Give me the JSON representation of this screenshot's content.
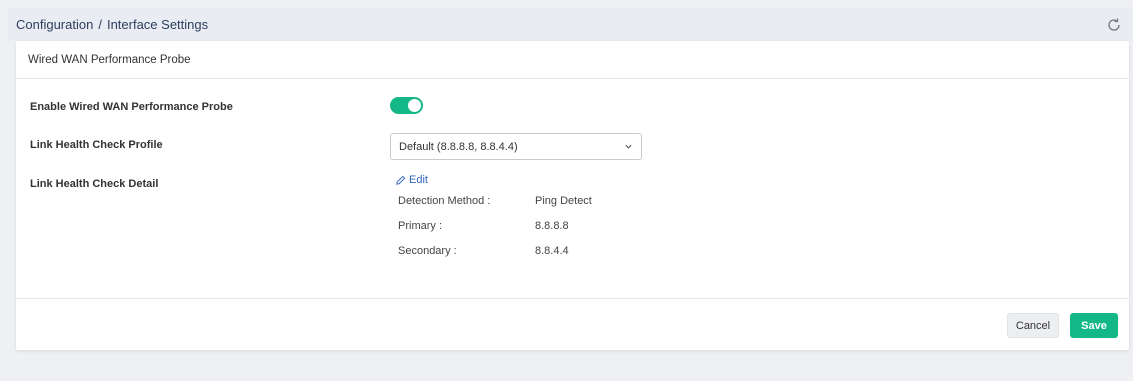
{
  "breadcrumb": {
    "section": "Configuration",
    "separator": "/",
    "page": "Interface Settings"
  },
  "card": {
    "title": "Wired WAN Performance Probe"
  },
  "form": {
    "enable_label": "Enable Wired WAN Performance Probe",
    "enable_state": "on",
    "profile_label": "Link Health Check Profile",
    "profile_value": "Default (8.8.8.8, 8.8.4.4)",
    "detail_label": "Link Health Check Detail",
    "edit_label": "Edit",
    "details": [
      {
        "label": "Detection Method :",
        "value": "Ping Detect"
      },
      {
        "label": "Primary :",
        "value": "8.8.8.8"
      },
      {
        "label": "Secondary :",
        "value": "8.8.4.4"
      }
    ]
  },
  "actions": {
    "cancel_label": "Cancel",
    "save_label": "Save"
  },
  "colors": {
    "accent": "#14b887",
    "link": "#2f64b8",
    "breadcrumb_text": "#2d3e5e"
  },
  "icons": {
    "refresh": "refresh-icon",
    "edit": "pencil-icon",
    "dropdown": "chevron-down-icon"
  }
}
